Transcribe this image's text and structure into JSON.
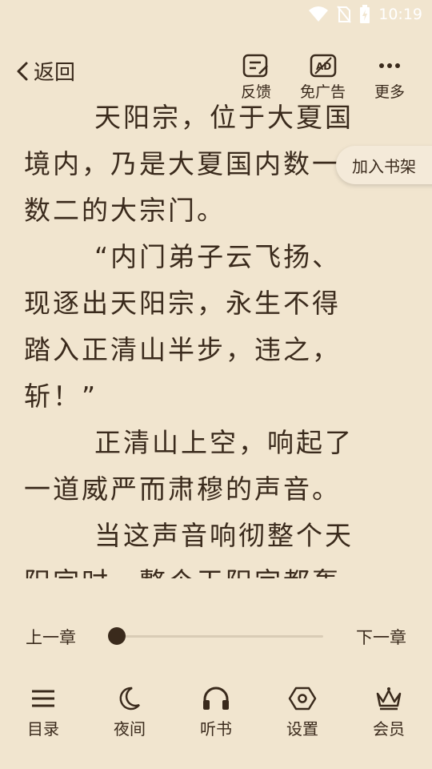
{
  "status": {
    "time": "10:19"
  },
  "toolbar": {
    "back_label": "返回",
    "feedback_label": "反馈",
    "no_ads_label": "免广告",
    "more_label": "更多"
  },
  "content": {
    "paragraphs": [
      "天阳宗，位于大夏国",
      "境内，乃是大夏国内数一",
      "数二的大宗门。",
      "“内门弟子云飞扬、",
      "现逐出天阳宗，永生不得",
      "踏入正清山半步，违之，",
      "斩！”",
      "正清山上空，响起了",
      "一道威严而肃穆的声音。",
      "当这声音响彻整个天",
      "阳宗时，整个天阳宗都轰"
    ]
  },
  "shelf_button_label": "加入书架",
  "chapter_nav": {
    "prev_label": "上一章",
    "next_label": "下一章",
    "progress": 0.0
  },
  "bottom_nav": {
    "items": [
      {
        "label": "目录",
        "icon": "menu-icon"
      },
      {
        "label": "夜间",
        "icon": "moon-icon"
      },
      {
        "label": "听书",
        "icon": "headphones-icon"
      },
      {
        "label": "设置",
        "icon": "settings-icon"
      },
      {
        "label": "会员",
        "icon": "crown-icon"
      }
    ]
  },
  "colors": {
    "background": "#f1e5cf",
    "text": "#3a2a1c"
  }
}
